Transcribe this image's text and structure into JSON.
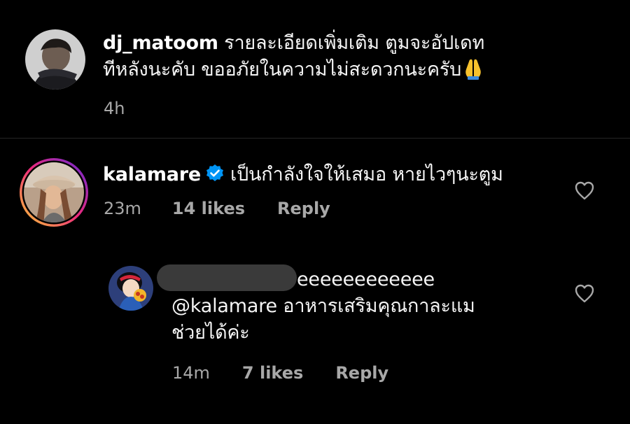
{
  "comments": [
    {
      "username": "dj_matoom",
      "text_line1": "รายละเอียดเพิ่มเติม ตูมจะอัปเดท",
      "text_line2": "ทีหลังนะคับ ขออภัยในความไม่สะดวกนะครับ",
      "emoji": "folded-hands",
      "time": "4h"
    },
    {
      "username": "kalamare",
      "verified": true,
      "text": "เป็นกำลังใจให้เสมอ หายไวๆนะตูม",
      "time": "23m",
      "likes": "14 likes",
      "reply_label": "Reply",
      "has_story_ring": true
    }
  ],
  "reply": {
    "username_visible_part": "eeeeeeeeeeee",
    "username_redacted": true,
    "text_line1": "@kalamare อาหารเสริมคุณกาละแม",
    "text_line2": "ช่วยได้ค่ะ",
    "time": "14m",
    "likes": "7 likes",
    "reply_label": "Reply"
  },
  "icons": {
    "like": "heart-outline-icon",
    "verified": "verified-badge-icon"
  },
  "colors": {
    "background": "#000000",
    "text_primary": "#f5f5f5",
    "text_secondary": "#a8a8a8",
    "verified_blue": "#0095f6",
    "story_ring_start": "#f9ce34",
    "story_ring_mid": "#ee2a7b",
    "story_ring_end": "#6228d7"
  }
}
